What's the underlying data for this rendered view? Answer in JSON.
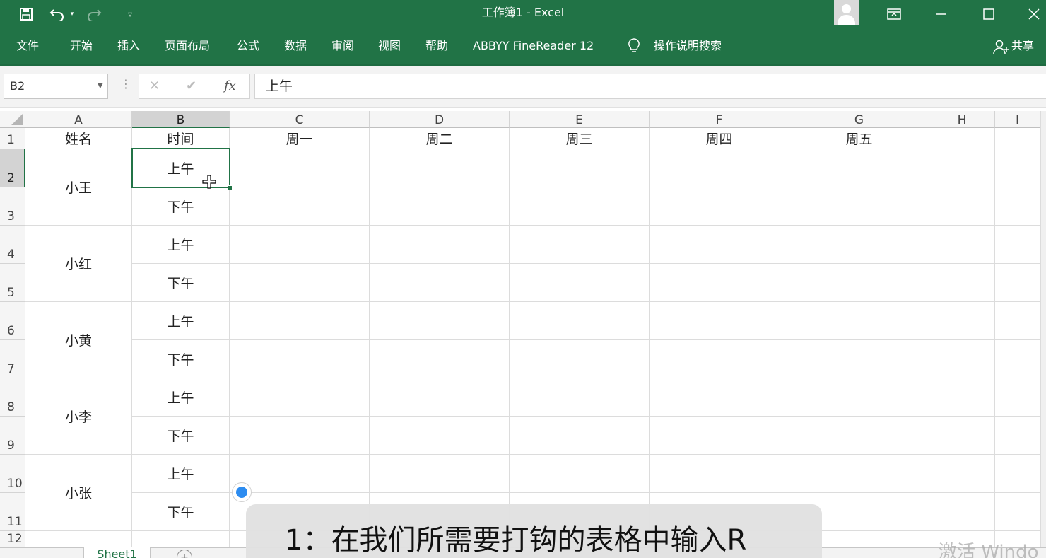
{
  "window": {
    "title": "工作簿1  -  Excel"
  },
  "ribbon": {
    "tabs": [
      "文件",
      "开始",
      "插入",
      "页面布局",
      "公式",
      "数据",
      "审阅",
      "视图",
      "帮助",
      "ABBYY FineReader 12"
    ],
    "tell_me": "操作说明搜索",
    "share": "共享"
  },
  "formula_bar": {
    "name_box": "B2",
    "fx_label": "fx",
    "value": "上午"
  },
  "sheet": {
    "columns": [
      "A",
      "B",
      "C",
      "D",
      "E",
      "F",
      "G",
      "H",
      "I"
    ],
    "rows": [
      "1",
      "2",
      "3",
      "4",
      "5",
      "6",
      "7",
      "8",
      "9",
      "10",
      "11",
      "12"
    ],
    "header_row": [
      "姓名",
      "时间",
      "周一",
      "周二",
      "周三",
      "周四",
      "周五"
    ],
    "names": [
      "小王",
      "小红",
      "小黄",
      "小李",
      "小张"
    ],
    "time_values": [
      "上午",
      "下午",
      "上午",
      "下午",
      "上午",
      "下午",
      "上午",
      "下午",
      "上午",
      "下午"
    ],
    "selected_cell": "B2"
  },
  "sheet_tabs": {
    "active": "Sheet1",
    "add": "+"
  },
  "caption": "1：在我们所需要打钩的表格中输入R",
  "watermark": "激活 Windo",
  "colors": {
    "brand": "#217346",
    "selection": "#217346",
    "accent_dot": "#2d8cf0"
  },
  "icons": [
    "save-icon",
    "undo-icon",
    "redo-icon",
    "customize-qat-icon",
    "ribbon-display-icon",
    "minimize-icon",
    "maximize-icon",
    "close-icon",
    "lightbulb-icon",
    "share-person-icon",
    "cancel-x-icon",
    "enter-check-icon",
    "move-cursor-icon"
  ]
}
